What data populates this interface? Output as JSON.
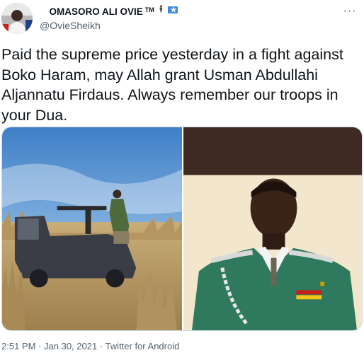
{
  "author": {
    "display_name": " OMASORO ALI OVIE",
    "display_suffix": "TM",
    "handle": "@OvieSheikh",
    "avatar": "avatar",
    "icons": [
      "trademark-icon",
      "figure-emoji-icon",
      "flag-icon"
    ]
  },
  "menu": {
    "more_label": "···"
  },
  "tweet": {
    "text": "Paid the supreme price yesterday in a fight against Boko Haram, may Allah grant Usman Abdullahi Aljannatu Firdaus. Always remember our troops in your Dua."
  },
  "media": {
    "photos": [
      {
        "name": "soldiers-on-pickup-truck-photo"
      },
      {
        "name": "soldier-portrait-photo"
      }
    ]
  },
  "meta": {
    "time": "2:51 PM",
    "separator": "·",
    "date": "Jan 30, 2021",
    "source": "Twitter for Android"
  },
  "colors": {
    "text": "#0f1419",
    "secondary": "#536471",
    "border": "#cfd9de",
    "flag": "#4189dd"
  }
}
